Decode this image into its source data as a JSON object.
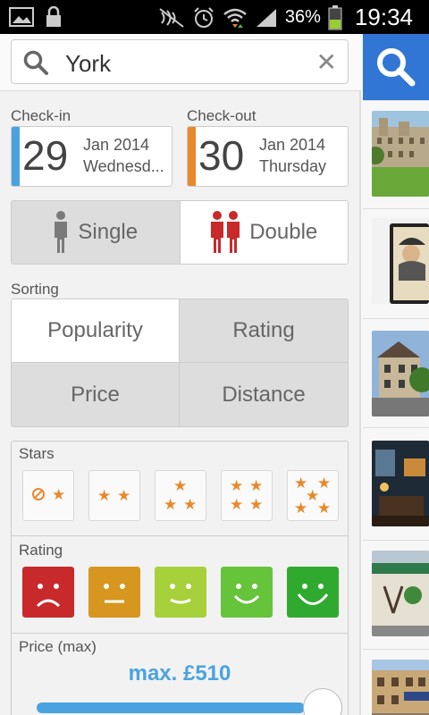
{
  "status_bar": {
    "battery_percent": "36%",
    "time": "19:34",
    "icons": [
      "image-icon",
      "lock-icon",
      "mute-icon",
      "alarm-icon",
      "wifi-icon",
      "signal-icon",
      "battery-icon"
    ]
  },
  "search": {
    "value": "York",
    "icon": "search-icon",
    "clear_icon": "close-icon"
  },
  "checkin": {
    "label": "Check-in",
    "day": "29",
    "month": "Jan 2014",
    "weekday": "Wednesd...",
    "accent": "#4aa3df"
  },
  "checkout": {
    "label": "Check-out",
    "day": "30",
    "month": "Jan 2014",
    "weekday": "Thursday",
    "accent": "#e8892c"
  },
  "room": {
    "single_label": "Single",
    "double_label": "Double",
    "selected": "Double"
  },
  "sorting": {
    "label": "Sorting",
    "options": [
      "Popularity",
      "Rating",
      "Price",
      "Distance"
    ],
    "selected": "Popularity"
  },
  "filters": {
    "stars_label": "Stars",
    "stars_options": [
      0,
      2,
      3,
      4,
      5
    ],
    "rating_label": "Rating",
    "rating_colors": [
      "#c8292b",
      "#d6961f",
      "#a6d13a",
      "#65c43a",
      "#2faa2f"
    ],
    "price_label": "Price (max)",
    "price_value": "max. £510",
    "price_slider_fraction": 1.0
  },
  "results": {
    "search_button_icon": "search-icon",
    "thumbnail_count": 6
  }
}
